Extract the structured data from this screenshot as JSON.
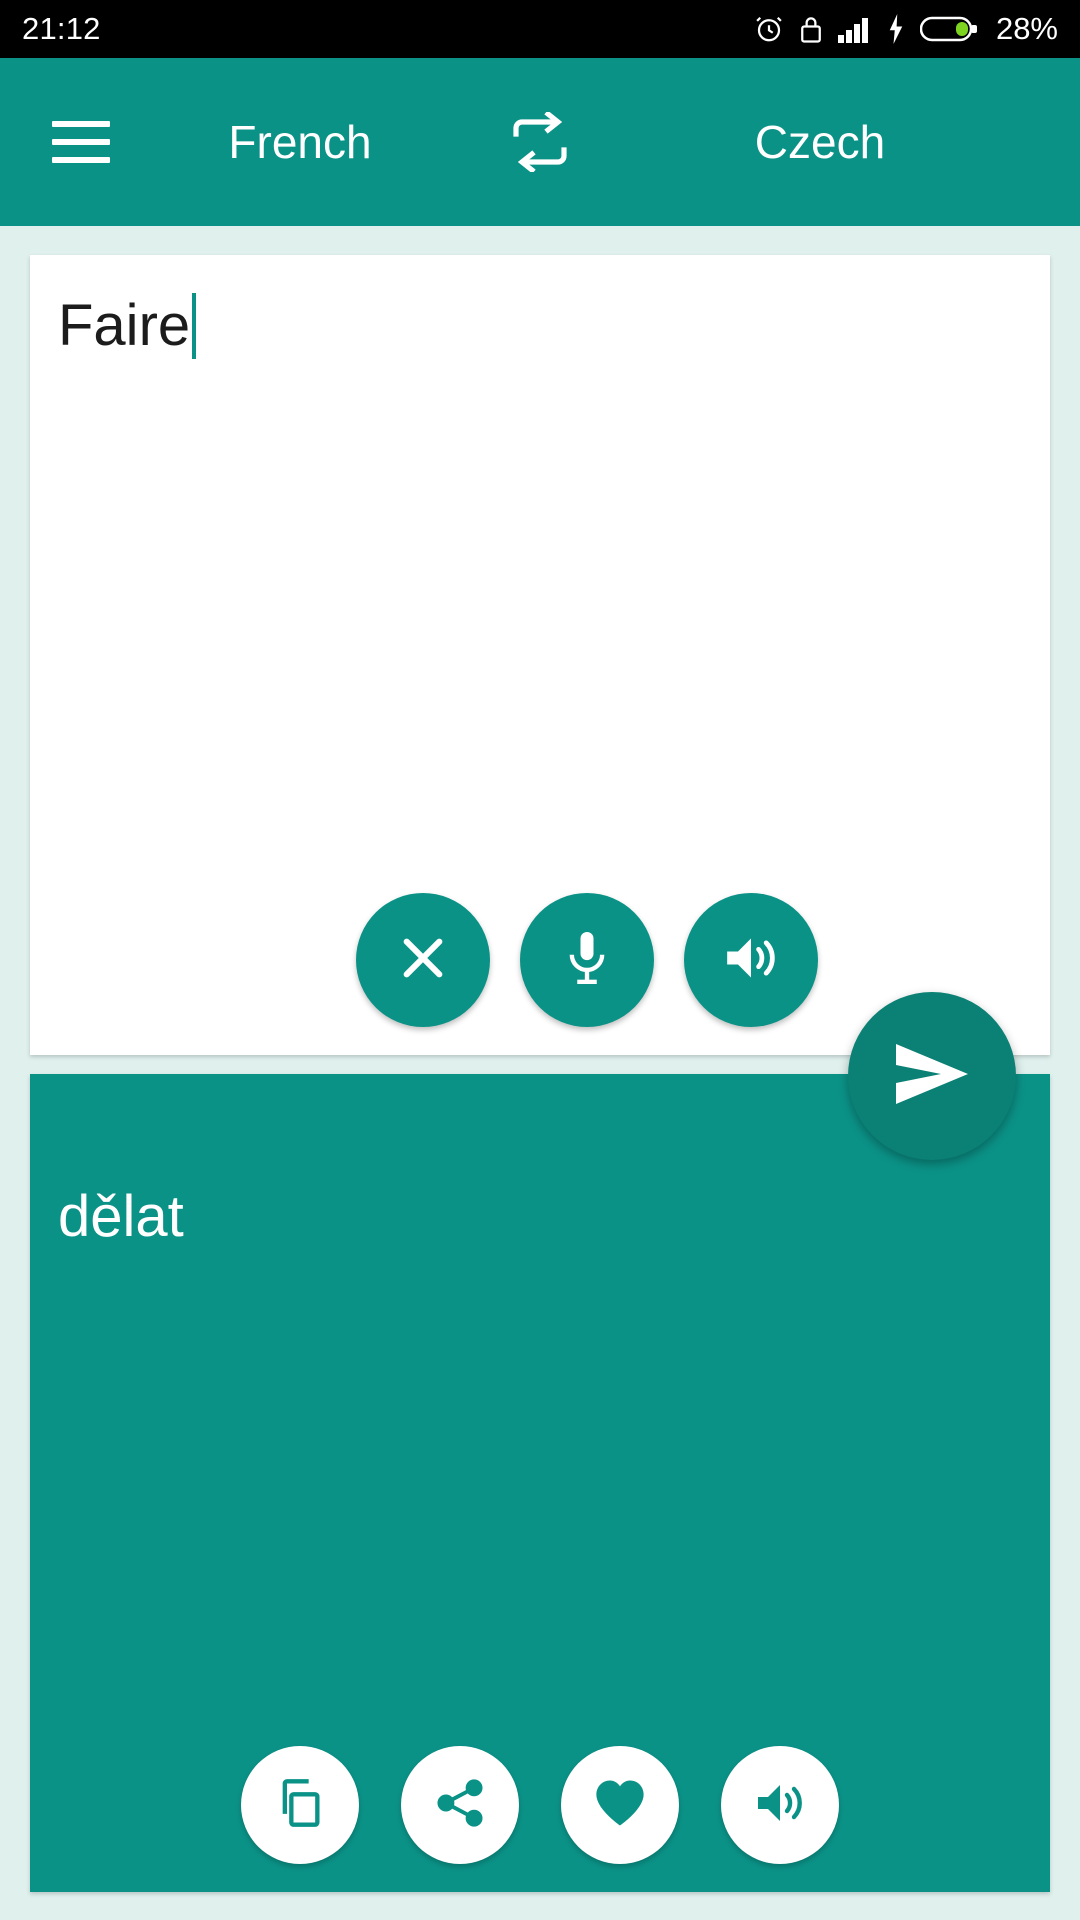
{
  "status_bar": {
    "time": "21:12",
    "battery_percent": "28%",
    "icons": [
      "alarm-icon",
      "lock-icon",
      "signal-icon",
      "charging-bolt-icon",
      "battery-icon"
    ]
  },
  "app_bar": {
    "menu_icon": "hamburger-menu-icon",
    "source_language": "French",
    "swap_icon": "swap-languages-icon",
    "target_language": "Czech"
  },
  "source_panel": {
    "text": "Faire",
    "placeholder": "",
    "actions": [
      {
        "name": "clear-button",
        "icon": "close-x-icon"
      },
      {
        "name": "voice-input-button",
        "icon": "microphone-icon"
      },
      {
        "name": "speak-source-button",
        "icon": "speaker-icon"
      }
    ]
  },
  "translate_button": {
    "name": "translate-send-button",
    "icon": "send-arrow-icon"
  },
  "target_panel": {
    "text": "dělat",
    "actions": [
      {
        "name": "copy-button",
        "icon": "copy-icon"
      },
      {
        "name": "share-button",
        "icon": "share-icon"
      },
      {
        "name": "favorite-button",
        "icon": "heart-icon"
      },
      {
        "name": "speak-target-button",
        "icon": "speaker-icon"
      }
    ]
  },
  "colors": {
    "primary": "#0b9287",
    "primary_dark": "#0b8075",
    "background": "#dff0ed",
    "card": "#ffffff",
    "status_bar": "#000000",
    "battery_fill": "#7ed321"
  }
}
